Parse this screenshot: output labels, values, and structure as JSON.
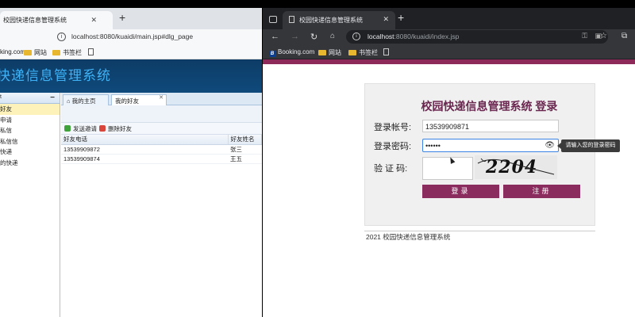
{
  "left_window": {
    "tab_title": "校园快递信息管理系统",
    "url": "localhost:8080/kuaidi/main.jsp#dlg_page",
    "bookmarks": [
      "king.com",
      "网站",
      "书签栏"
    ],
    "app_title": "快递信息管理系统",
    "sidebar": {
      "header": "t",
      "items": [
        "好友",
        "申请",
        "私信",
        "私信信",
        "快递",
        "的快递"
      ],
      "selected_index": 0
    },
    "main_tabs": [
      "我的主页",
      "我的好友"
    ],
    "toolbar": {
      "send_invite": "发送邀请",
      "delete_friend": "删除好友"
    },
    "table": {
      "headers": [
        "好友电话",
        "好友姓名"
      ],
      "rows": [
        [
          "13539909872",
          "张三"
        ],
        [
          "13539909874",
          "王五"
        ]
      ]
    }
  },
  "right_window": {
    "tab_title": "校园快递信息管理系统",
    "url_host": "localhost",
    "url_path": ":8080/kuaidi/index.jsp",
    "bookmarks": {
      "booking": "Booking.com",
      "folder1": "网站",
      "folder2": "书签栏"
    },
    "login": {
      "title": "校园快递信息管理系统 登录",
      "account_label": "登录帐号:",
      "account_value": "13539909871",
      "password_label": "登录密码:",
      "password_value": "••••••",
      "captcha_label": "验 证 码:",
      "captcha_text": "2204",
      "login_button": "登录",
      "register_button": "注册",
      "tooltip": "请输入您的登录密码"
    },
    "footer": "2021 校园快递信息管理系统",
    "accent_color": "#8e2a5a"
  }
}
